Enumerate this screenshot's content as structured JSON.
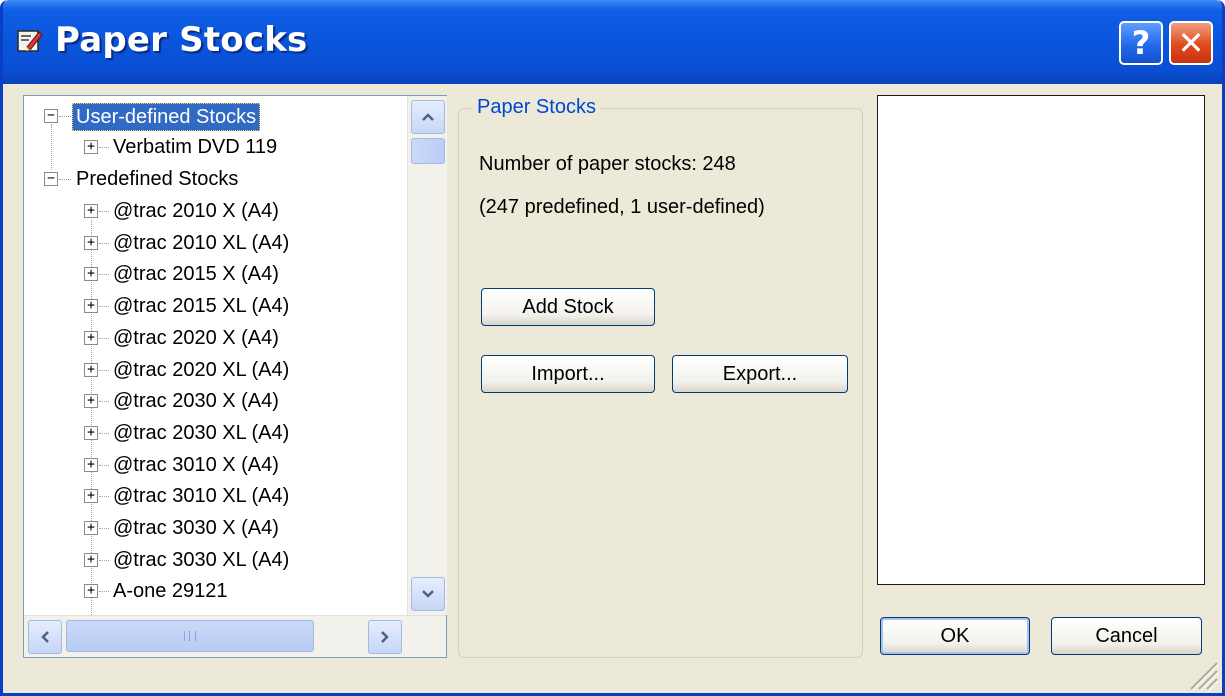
{
  "window": {
    "title": "Paper Stocks",
    "help_label": "?",
    "close_label": "✕"
  },
  "tree": {
    "user_group": {
      "label": "User-defined Stocks",
      "children": [
        "Verbatim DVD 119"
      ]
    },
    "predefined_group": {
      "label": "Predefined Stocks",
      "children": [
        "@trac 2010 X (A4)",
        "@trac 2010 XL (A4)",
        "@trac 2015 X (A4)",
        "@trac 2015 XL (A4)",
        "@trac 2020 X (A4)",
        "@trac 2020 XL (A4)",
        "@trac 2030 X (A4)",
        "@trac 2030 XL (A4)",
        "@trac 3010 X (A4)",
        "@trac 3010 XL (A4)",
        "@trac 3030 X (A4)",
        "@trac 3030 XL (A4)",
        "A-one 29121"
      ]
    },
    "expand_glyph": "+",
    "collapse_glyph": "−"
  },
  "group": {
    "title": "Paper Stocks",
    "count_text": "Number of paper stocks: 248",
    "detail_text": "(247 predefined, 1 user-defined)"
  },
  "buttons": {
    "add_stock": "Add Stock",
    "import": "Import...",
    "export": "Export...",
    "ok": "OK",
    "cancel": "Cancel"
  },
  "colors": {
    "titlebar": "#0a55dd",
    "selection": "#316ac5",
    "group_title": "#0046d5",
    "dialog_bg": "#ece9d8"
  }
}
